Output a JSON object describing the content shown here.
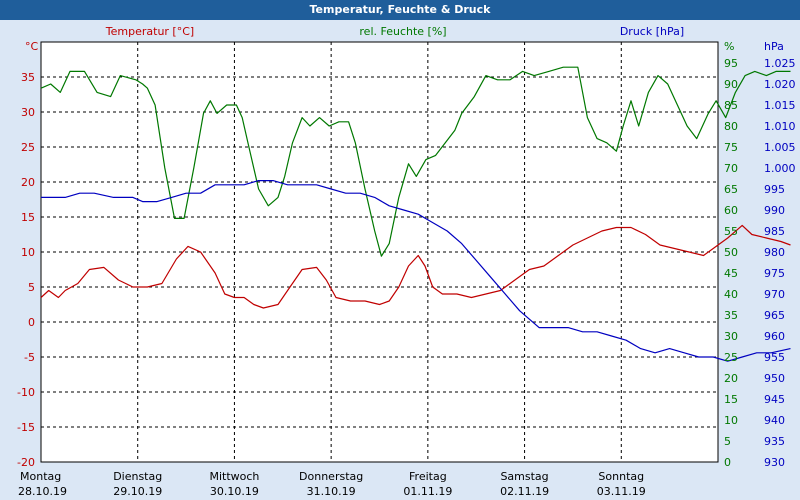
{
  "window": {
    "title": "Temperatur, Feuchte & Druck"
  },
  "colors": {
    "temp": "#c00000",
    "humid": "#007800",
    "press": "#0000c0",
    "bg": "#dbe7f5",
    "plot_bg": "#ffffff",
    "title_bg": "#1f5e9b"
  },
  "chart_data": {
    "type": "line",
    "title": "Temperatur, Feuchte & Druck",
    "grid": true,
    "x_range": [
      0,
      7
    ],
    "x_ticks": [
      {
        "day": "Montag",
        "date": "28.10.19"
      },
      {
        "day": "Dienstag",
        "date": "29.10.19"
      },
      {
        "day": "Mittwoch",
        "date": "30.10.19"
      },
      {
        "day": "Donnerstag",
        "date": "31.10.19"
      },
      {
        "day": "Freitag",
        "date": "01.11.19"
      },
      {
        "day": "Samstag",
        "date": "02.11.19"
      },
      {
        "day": "Sonntag",
        "date": "03.11.19"
      }
    ],
    "axes": {
      "temp": {
        "label": "Temperatur [°C]",
        "unit": "°C",
        "min": -20,
        "max": 40,
        "ticks": [
          -20,
          -15,
          -10,
          -5,
          0,
          5,
          10,
          15,
          20,
          25,
          30,
          35
        ]
      },
      "humid": {
        "label": "rel. Feuchte [%]",
        "unit": "%",
        "min": 0,
        "max": 100,
        "ticks": [
          0,
          5,
          10,
          15,
          20,
          25,
          30,
          35,
          40,
          45,
          50,
          55,
          60,
          65,
          70,
          75,
          80,
          85,
          90,
          95
        ]
      },
      "press": {
        "label": "Druck [hPa]",
        "unit": "hPa",
        "min": 930,
        "max": 1030,
        "ticks": [
          "930",
          "935",
          "940",
          "945",
          "950",
          "955",
          "960",
          "965",
          "970",
          "975",
          "980",
          "985",
          "990",
          "995",
          "1.000",
          "1.005",
          "1.010",
          "1.015",
          "1.020",
          "1.025"
        ]
      }
    },
    "series": [
      {
        "name": "Temperatur [°C]",
        "axis": "temp",
        "points": [
          [
            0,
            3.5
          ],
          [
            0.08,
            4.5
          ],
          [
            0.18,
            3.5
          ],
          [
            0.25,
            4.5
          ],
          [
            0.38,
            5.5
          ],
          [
            0.5,
            7.5
          ],
          [
            0.65,
            7.8
          ],
          [
            0.8,
            6
          ],
          [
            0.95,
            5
          ],
          [
            1.1,
            5
          ],
          [
            1.25,
            5.5
          ],
          [
            1.4,
            9
          ],
          [
            1.52,
            10.8
          ],
          [
            1.65,
            10
          ],
          [
            1.8,
            7
          ],
          [
            1.9,
            4
          ],
          [
            2.0,
            3.5
          ],
          [
            2.1,
            3.5
          ],
          [
            2.2,
            2.5
          ],
          [
            2.3,
            2
          ],
          [
            2.45,
            2.5
          ],
          [
            2.55,
            4.5
          ],
          [
            2.7,
            7.5
          ],
          [
            2.85,
            7.8
          ],
          [
            2.95,
            6
          ],
          [
            3.05,
            3.5
          ],
          [
            3.2,
            3
          ],
          [
            3.35,
            3
          ],
          [
            3.5,
            2.5
          ],
          [
            3.6,
            3
          ],
          [
            3.7,
            5
          ],
          [
            3.8,
            8
          ],
          [
            3.9,
            9.5
          ],
          [
            3.97,
            8
          ],
          [
            4.05,
            5
          ],
          [
            4.15,
            4
          ],
          [
            4.3,
            4
          ],
          [
            4.45,
            3.5
          ],
          [
            4.6,
            4
          ],
          [
            4.75,
            4.5
          ],
          [
            4.9,
            6
          ],
          [
            5.05,
            7.5
          ],
          [
            5.2,
            8
          ],
          [
            5.35,
            9.5
          ],
          [
            5.5,
            11
          ],
          [
            5.65,
            12
          ],
          [
            5.8,
            13
          ],
          [
            5.95,
            13.5
          ],
          [
            6.1,
            13.5
          ],
          [
            6.25,
            12.5
          ],
          [
            6.4,
            11
          ],
          [
            6.55,
            10.5
          ],
          [
            6.7,
            10
          ],
          [
            6.85,
            9.5
          ],
          [
            6.95,
            10.5
          ],
          [
            7.1,
            12
          ],
          [
            7.25,
            13.8
          ],
          [
            7.35,
            12.5
          ],
          [
            7.5,
            12
          ],
          [
            7.65,
            11.5
          ],
          [
            7.75,
            11
          ]
        ]
      },
      {
        "name": "rel. Feuchte [%]",
        "axis": "humid",
        "points": [
          [
            0,
            89
          ],
          [
            0.1,
            90
          ],
          [
            0.2,
            88
          ],
          [
            0.3,
            93
          ],
          [
            0.45,
            93
          ],
          [
            0.58,
            88
          ],
          [
            0.72,
            87
          ],
          [
            0.82,
            92
          ],
          [
            0.98,
            91
          ],
          [
            1.05,
            90
          ],
          [
            1.1,
            89
          ],
          [
            1.18,
            85
          ],
          [
            1.28,
            70
          ],
          [
            1.38,
            58
          ],
          [
            1.48,
            58
          ],
          [
            1.58,
            70
          ],
          [
            1.68,
            83
          ],
          [
            1.75,
            86
          ],
          [
            1.82,
            83
          ],
          [
            1.92,
            85
          ],
          [
            2.02,
            85
          ],
          [
            2.08,
            82
          ],
          [
            2.15,
            75
          ],
          [
            2.25,
            65
          ],
          [
            2.35,
            61
          ],
          [
            2.45,
            63
          ],
          [
            2.52,
            68
          ],
          [
            2.6,
            76
          ],
          [
            2.7,
            82
          ],
          [
            2.78,
            80
          ],
          [
            2.88,
            82
          ],
          [
            2.98,
            80
          ],
          [
            3.08,
            81
          ],
          [
            3.18,
            81
          ],
          [
            3.25,
            76
          ],
          [
            3.35,
            65
          ],
          [
            3.45,
            55
          ],
          [
            3.52,
            49
          ],
          [
            3.6,
            52
          ],
          [
            3.7,
            63
          ],
          [
            3.8,
            71
          ],
          [
            3.88,
            68
          ],
          [
            3.98,
            72
          ],
          [
            4.08,
            73
          ],
          [
            4.18,
            76
          ],
          [
            4.28,
            79
          ],
          [
            4.35,
            83
          ],
          [
            4.48,
            87
          ],
          [
            4.6,
            92
          ],
          [
            4.72,
            91
          ],
          [
            4.85,
            91
          ],
          [
            4.98,
            93
          ],
          [
            5.1,
            92
          ],
          [
            5.25,
            93
          ],
          [
            5.4,
            94
          ],
          [
            5.55,
            94
          ],
          [
            5.65,
            82
          ],
          [
            5.75,
            77
          ],
          [
            5.85,
            76
          ],
          [
            5.95,
            74
          ],
          [
            6.02,
            80
          ],
          [
            6.1,
            86
          ],
          [
            6.18,
            80
          ],
          [
            6.28,
            88
          ],
          [
            6.38,
            92
          ],
          [
            6.48,
            90
          ],
          [
            6.58,
            85
          ],
          [
            6.68,
            80
          ],
          [
            6.78,
            77
          ],
          [
            6.9,
            83
          ],
          [
            6.98,
            86
          ],
          [
            7.08,
            82
          ],
          [
            7.18,
            88
          ],
          [
            7.28,
            92
          ],
          [
            7.38,
            93
          ],
          [
            7.5,
            92
          ],
          [
            7.6,
            93
          ],
          [
            7.75,
            93
          ]
        ]
      },
      {
        "name": "Druck [hPa]",
        "axis": "press",
        "points": [
          [
            0,
            993
          ],
          [
            0.25,
            993
          ],
          [
            0.4,
            994
          ],
          [
            0.55,
            994
          ],
          [
            0.75,
            993
          ],
          [
            0.95,
            993
          ],
          [
            1.05,
            992
          ],
          [
            1.2,
            992
          ],
          [
            1.35,
            993
          ],
          [
            1.5,
            994
          ],
          [
            1.65,
            994
          ],
          [
            1.8,
            996
          ],
          [
            1.95,
            996
          ],
          [
            2.1,
            996
          ],
          [
            2.25,
            997
          ],
          [
            2.4,
            997
          ],
          [
            2.55,
            996
          ],
          [
            2.7,
            996
          ],
          [
            2.85,
            996
          ],
          [
            3.0,
            995
          ],
          [
            3.15,
            994
          ],
          [
            3.3,
            994
          ],
          [
            3.45,
            993
          ],
          [
            3.6,
            991
          ],
          [
            3.75,
            990
          ],
          [
            3.9,
            989
          ],
          [
            4.05,
            987
          ],
          [
            4.2,
            985
          ],
          [
            4.35,
            982
          ],
          [
            4.5,
            978
          ],
          [
            4.65,
            974
          ],
          [
            4.8,
            970
          ],
          [
            4.95,
            966
          ],
          [
            5.05,
            964
          ],
          [
            5.15,
            962
          ],
          [
            5.3,
            962
          ],
          [
            5.45,
            962
          ],
          [
            5.6,
            961
          ],
          [
            5.75,
            961
          ],
          [
            5.9,
            960
          ],
          [
            6.05,
            959
          ],
          [
            6.2,
            957
          ],
          [
            6.35,
            956
          ],
          [
            6.5,
            957
          ],
          [
            6.65,
            956
          ],
          [
            6.8,
            955
          ],
          [
            6.95,
            955
          ],
          [
            7.1,
            954
          ],
          [
            7.25,
            955
          ],
          [
            7.4,
            956
          ],
          [
            7.55,
            956
          ],
          [
            7.75,
            957
          ]
        ]
      }
    ]
  }
}
